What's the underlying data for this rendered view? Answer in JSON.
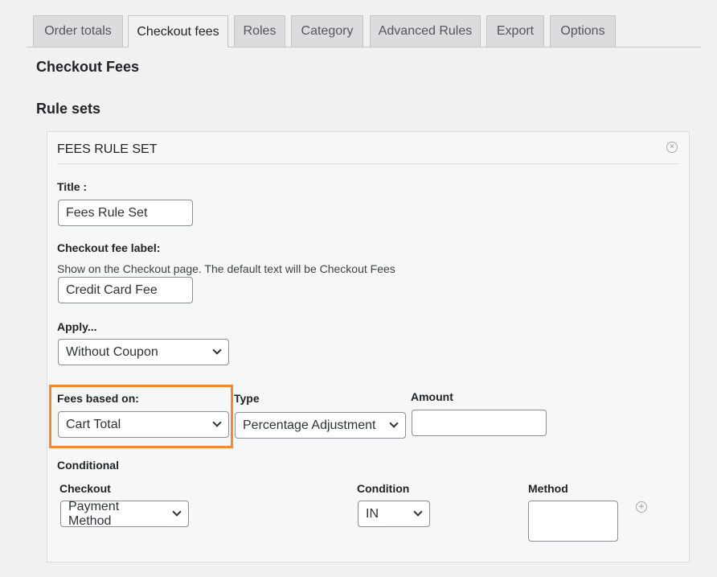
{
  "tabs": [
    {
      "label": "Order totals",
      "active": false
    },
    {
      "label": "Checkout fees",
      "active": true
    },
    {
      "label": "Roles",
      "active": false
    },
    {
      "label": "Category",
      "active": false
    },
    {
      "label": "Advanced Rules",
      "active": false
    },
    {
      "label": "Export",
      "active": false
    },
    {
      "label": "Options",
      "active": false
    }
  ],
  "page_title": "Checkout Fees",
  "section_title": "Rule sets",
  "ruleset": {
    "heading": "FEES RULE SET",
    "close_icon": "×",
    "title_label": "Title :",
    "title_value": "Fees Rule Set",
    "fee_label_label": "Checkout fee label:",
    "fee_label_desc": "Show on the Checkout page. The default text will be Checkout Fees",
    "fee_label_value": "Credit Card Fee",
    "apply_label": "Apply...",
    "apply_value": "Without Coupon",
    "fees_based_label": "Fees based on:",
    "fees_based_value": "Cart Total",
    "type_label": "Type",
    "type_value": "Percentage Adjustment",
    "amount_label": "Amount",
    "amount_value": "",
    "conditional_label": "Conditional",
    "checkout_label": "Checkout",
    "checkout_value": "Payment Method",
    "condition_label": "Condition",
    "condition_value": "IN",
    "method_label": "Method",
    "add_icon": "+"
  },
  "colors": {
    "highlight": "#f5892b",
    "background": "#f1f1f1"
  }
}
